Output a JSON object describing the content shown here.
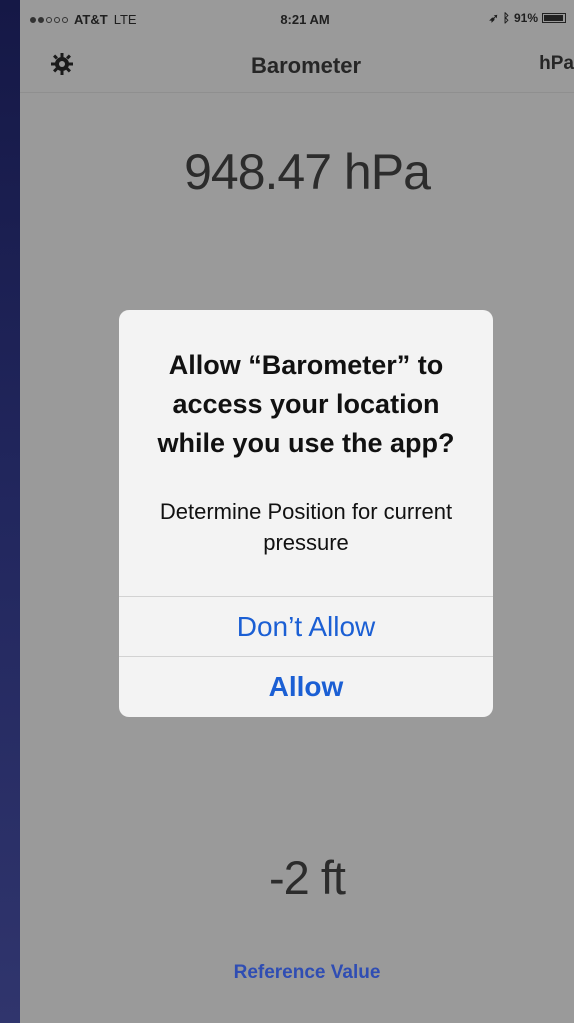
{
  "status_bar": {
    "carrier": "AT&T",
    "network": "LTE",
    "time": "8:21 AM",
    "battery": "91%",
    "icons": [
      "signal-icon",
      "location-arrow-icon",
      "bluetooth-icon",
      "battery-icon"
    ]
  },
  "nav": {
    "title": "Barometer",
    "unit": "hPa",
    "settings_icon": "gear-icon"
  },
  "main": {
    "pressure": "948.47 hPa",
    "altitude": "-2 ft",
    "reference_label": "Reference Value"
  },
  "dialog": {
    "title": "Allow “Barometer” to access your location while you use the app?",
    "message": "Determine Position for current pressure",
    "dont_allow": "Don’t Allow",
    "allow": "Allow"
  },
  "colors": {
    "screen_bg": "#9a9a9a",
    "dialog_bg": "#f3f3f3",
    "accent": "#1b5fd4",
    "reference": "#2f4db3",
    "outer_bg": "#2b2f63"
  }
}
